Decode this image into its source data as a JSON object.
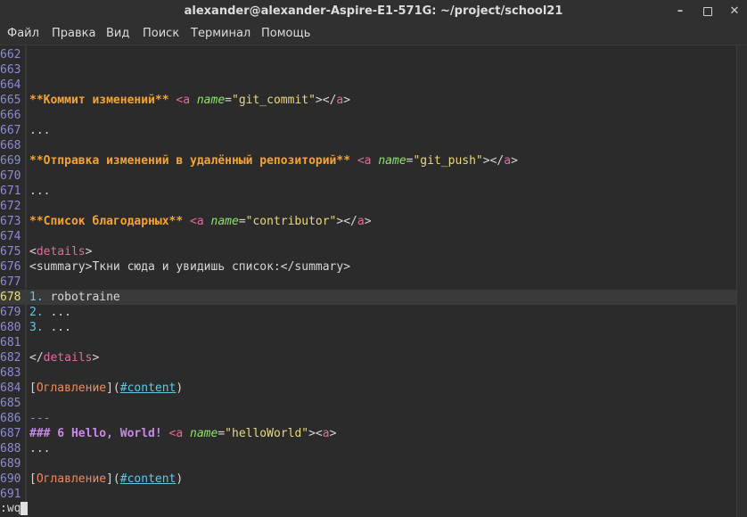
{
  "window": {
    "title": "alexander@alexander-Aspire-E1-571G: ~/project/school21",
    "controls": {
      "minimize": "–",
      "maximize": "",
      "close": "✕"
    }
  },
  "menu": [
    "Файл",
    "Правка",
    "Вид",
    "Поиск",
    "Терминал",
    "Помощь"
  ],
  "editor": {
    "current_line": 678,
    "lines": [
      {
        "n": "662",
        "segs": []
      },
      {
        "n": "663",
        "segs": []
      },
      {
        "n": "664",
        "segs": []
      },
      {
        "n": "665",
        "segs": [
          [
            "**Коммит изменений**",
            "bold-orange"
          ],
          [
            " ",
            "plain"
          ],
          [
            "<a",
            "tag"
          ],
          [
            " ",
            "plain"
          ],
          [
            "name",
            "attr"
          ],
          [
            "=",
            "plain"
          ],
          [
            "\"git_commit\"",
            "str"
          ],
          [
            "></",
            "plain"
          ],
          [
            "a",
            "tag"
          ],
          [
            ">",
            "plain"
          ]
        ]
      },
      {
        "n": "666",
        "segs": []
      },
      {
        "n": "667",
        "segs": [
          [
            "...",
            "plain"
          ]
        ]
      },
      {
        "n": "668",
        "segs": []
      },
      {
        "n": "669",
        "segs": [
          [
            "**Отправка изменений в удалённый репозиторий**",
            "bold-orange"
          ],
          [
            " ",
            "plain"
          ],
          [
            "<a",
            "tag"
          ],
          [
            " ",
            "plain"
          ],
          [
            "name",
            "attr"
          ],
          [
            "=",
            "plain"
          ],
          [
            "\"git_push\"",
            "str"
          ],
          [
            "></",
            "plain"
          ],
          [
            "a",
            "tag"
          ],
          [
            ">",
            "plain"
          ]
        ]
      },
      {
        "n": "670",
        "segs": []
      },
      {
        "n": "671",
        "segs": [
          [
            "...",
            "plain"
          ]
        ]
      },
      {
        "n": "672",
        "segs": []
      },
      {
        "n": "673",
        "segs": [
          [
            "**Список благодарных**",
            "bold-orange"
          ],
          [
            " ",
            "plain"
          ],
          [
            "<a",
            "tag"
          ],
          [
            " ",
            "plain"
          ],
          [
            "name",
            "attr"
          ],
          [
            "=",
            "plain"
          ],
          [
            "\"contributor\"",
            "str"
          ],
          [
            "></",
            "plain"
          ],
          [
            "a",
            "tag"
          ],
          [
            ">",
            "plain"
          ]
        ]
      },
      {
        "n": "674",
        "segs": []
      },
      {
        "n": "675",
        "segs": [
          [
            "<",
            "plain"
          ],
          [
            "details",
            "tag"
          ],
          [
            ">",
            "plain"
          ]
        ]
      },
      {
        "n": "676",
        "segs": [
          [
            "<summary>Ткни сюда и увидишь список:</summary>",
            "plain"
          ]
        ]
      },
      {
        "n": "677",
        "segs": []
      },
      {
        "n": "678",
        "segs": [
          [
            "1.",
            "listnum"
          ],
          [
            " robotraine",
            "plain"
          ]
        ]
      },
      {
        "n": "679",
        "segs": [
          [
            "2.",
            "listnum"
          ],
          [
            " ...",
            "plain"
          ]
        ]
      },
      {
        "n": "680",
        "segs": [
          [
            "3.",
            "listnum"
          ],
          [
            " ...",
            "plain"
          ]
        ]
      },
      {
        "n": "681",
        "segs": []
      },
      {
        "n": "682",
        "segs": [
          [
            "</",
            "plain"
          ],
          [
            "details",
            "tag"
          ],
          [
            ">",
            "plain"
          ]
        ]
      },
      {
        "n": "683",
        "segs": []
      },
      {
        "n": "684",
        "segs": [
          [
            "[",
            "plain"
          ],
          [
            "Оглавление",
            "link-text"
          ],
          [
            "](",
            "plain"
          ],
          [
            "#content",
            "link-url"
          ],
          [
            ")",
            "plain"
          ]
        ]
      },
      {
        "n": "685",
        "segs": []
      },
      {
        "n": "686",
        "segs": [
          [
            "---",
            "hr"
          ]
        ]
      },
      {
        "n": "687",
        "segs": [
          [
            "### 6 Hello, World!",
            "heading"
          ],
          [
            " ",
            "plain"
          ],
          [
            "<a",
            "tag"
          ],
          [
            " ",
            "plain"
          ],
          [
            "name",
            "attr"
          ],
          [
            "=",
            "plain"
          ],
          [
            "\"helloWorld\"",
            "str"
          ],
          [
            "><",
            "plain"
          ],
          [
            "a",
            "tag"
          ],
          [
            ">",
            "plain"
          ]
        ]
      },
      {
        "n": "688",
        "segs": [
          [
            "...",
            "plain"
          ]
        ]
      },
      {
        "n": "689",
        "segs": []
      },
      {
        "n": "690",
        "segs": [
          [
            "[",
            "plain"
          ],
          [
            "Оглавление",
            "link-text"
          ],
          [
            "](",
            "plain"
          ],
          [
            "#content",
            "link-url"
          ],
          [
            ")",
            "plain"
          ]
        ]
      },
      {
        "n": "691",
        "segs": []
      }
    ]
  },
  "command_line": ":wq"
}
